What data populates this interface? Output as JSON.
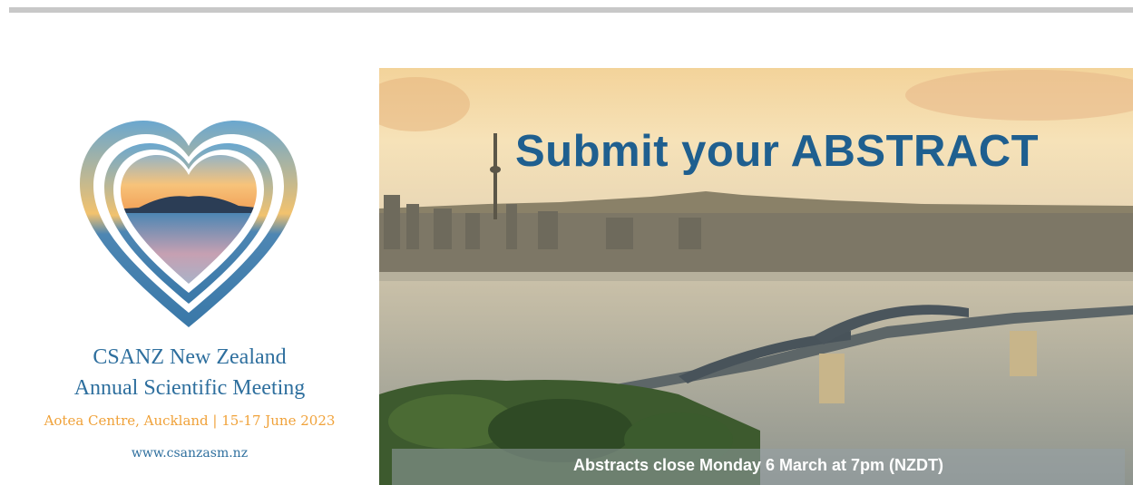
{
  "logo": {
    "icon": "heart-icon",
    "colors": {
      "blue": "#3b7fb0",
      "orange": "#f3b65d"
    }
  },
  "meeting": {
    "line1": "CSANZ New Zealand",
    "line2": "Annual Scientific Meeting",
    "venue": "Aotea Centre, Auckland | 15-17 June 2023",
    "website": "www.csanzasm.nz"
  },
  "banner": {
    "headline": "Submit your ABSTRACT",
    "deadline": "Abstracts close Monday 6 March at 7pm (NZDT)"
  },
  "colors": {
    "headline": "#1f5f8f",
    "accent_orange": "#f0a23a",
    "text_blue": "#2e6f9e"
  }
}
